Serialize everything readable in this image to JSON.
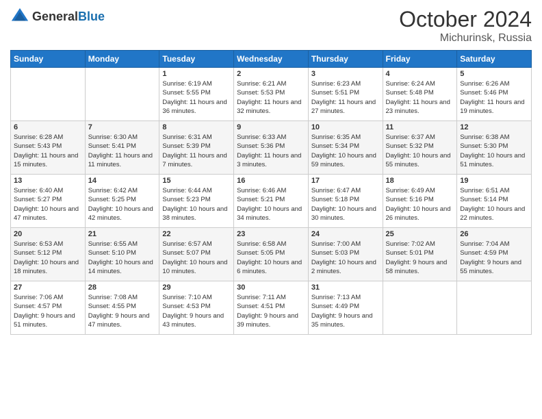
{
  "logo": {
    "general": "General",
    "blue": "Blue"
  },
  "header": {
    "month": "October 2024",
    "location": "Michurinsk, Russia"
  },
  "weekdays": [
    "Sunday",
    "Monday",
    "Tuesday",
    "Wednesday",
    "Thursday",
    "Friday",
    "Saturday"
  ],
  "weeks": [
    [
      {
        "day": "",
        "sunrise": "",
        "sunset": "",
        "daylight": ""
      },
      {
        "day": "",
        "sunrise": "",
        "sunset": "",
        "daylight": ""
      },
      {
        "day": "1",
        "sunrise": "Sunrise: 6:19 AM",
        "sunset": "Sunset: 5:55 PM",
        "daylight": "Daylight: 11 hours and 36 minutes."
      },
      {
        "day": "2",
        "sunrise": "Sunrise: 6:21 AM",
        "sunset": "Sunset: 5:53 PM",
        "daylight": "Daylight: 11 hours and 32 minutes."
      },
      {
        "day": "3",
        "sunrise": "Sunrise: 6:23 AM",
        "sunset": "Sunset: 5:51 PM",
        "daylight": "Daylight: 11 hours and 27 minutes."
      },
      {
        "day": "4",
        "sunrise": "Sunrise: 6:24 AM",
        "sunset": "Sunset: 5:48 PM",
        "daylight": "Daylight: 11 hours and 23 minutes."
      },
      {
        "day": "5",
        "sunrise": "Sunrise: 6:26 AM",
        "sunset": "Sunset: 5:46 PM",
        "daylight": "Daylight: 11 hours and 19 minutes."
      }
    ],
    [
      {
        "day": "6",
        "sunrise": "Sunrise: 6:28 AM",
        "sunset": "Sunset: 5:43 PM",
        "daylight": "Daylight: 11 hours and 15 minutes."
      },
      {
        "day": "7",
        "sunrise": "Sunrise: 6:30 AM",
        "sunset": "Sunset: 5:41 PM",
        "daylight": "Daylight: 11 hours and 11 minutes."
      },
      {
        "day": "8",
        "sunrise": "Sunrise: 6:31 AM",
        "sunset": "Sunset: 5:39 PM",
        "daylight": "Daylight: 11 hours and 7 minutes."
      },
      {
        "day": "9",
        "sunrise": "Sunrise: 6:33 AM",
        "sunset": "Sunset: 5:36 PM",
        "daylight": "Daylight: 11 hours and 3 minutes."
      },
      {
        "day": "10",
        "sunrise": "Sunrise: 6:35 AM",
        "sunset": "Sunset: 5:34 PM",
        "daylight": "Daylight: 10 hours and 59 minutes."
      },
      {
        "day": "11",
        "sunrise": "Sunrise: 6:37 AM",
        "sunset": "Sunset: 5:32 PM",
        "daylight": "Daylight: 10 hours and 55 minutes."
      },
      {
        "day": "12",
        "sunrise": "Sunrise: 6:38 AM",
        "sunset": "Sunset: 5:30 PM",
        "daylight": "Daylight: 10 hours and 51 minutes."
      }
    ],
    [
      {
        "day": "13",
        "sunrise": "Sunrise: 6:40 AM",
        "sunset": "Sunset: 5:27 PM",
        "daylight": "Daylight: 10 hours and 47 minutes."
      },
      {
        "day": "14",
        "sunrise": "Sunrise: 6:42 AM",
        "sunset": "Sunset: 5:25 PM",
        "daylight": "Daylight: 10 hours and 42 minutes."
      },
      {
        "day": "15",
        "sunrise": "Sunrise: 6:44 AM",
        "sunset": "Sunset: 5:23 PM",
        "daylight": "Daylight: 10 hours and 38 minutes."
      },
      {
        "day": "16",
        "sunrise": "Sunrise: 6:46 AM",
        "sunset": "Sunset: 5:21 PM",
        "daylight": "Daylight: 10 hours and 34 minutes."
      },
      {
        "day": "17",
        "sunrise": "Sunrise: 6:47 AM",
        "sunset": "Sunset: 5:18 PM",
        "daylight": "Daylight: 10 hours and 30 minutes."
      },
      {
        "day": "18",
        "sunrise": "Sunrise: 6:49 AM",
        "sunset": "Sunset: 5:16 PM",
        "daylight": "Daylight: 10 hours and 26 minutes."
      },
      {
        "day": "19",
        "sunrise": "Sunrise: 6:51 AM",
        "sunset": "Sunset: 5:14 PM",
        "daylight": "Daylight: 10 hours and 22 minutes."
      }
    ],
    [
      {
        "day": "20",
        "sunrise": "Sunrise: 6:53 AM",
        "sunset": "Sunset: 5:12 PM",
        "daylight": "Daylight: 10 hours and 18 minutes."
      },
      {
        "day": "21",
        "sunrise": "Sunrise: 6:55 AM",
        "sunset": "Sunset: 5:10 PM",
        "daylight": "Daylight: 10 hours and 14 minutes."
      },
      {
        "day": "22",
        "sunrise": "Sunrise: 6:57 AM",
        "sunset": "Sunset: 5:07 PM",
        "daylight": "Daylight: 10 hours and 10 minutes."
      },
      {
        "day": "23",
        "sunrise": "Sunrise: 6:58 AM",
        "sunset": "Sunset: 5:05 PM",
        "daylight": "Daylight: 10 hours and 6 minutes."
      },
      {
        "day": "24",
        "sunrise": "Sunrise: 7:00 AM",
        "sunset": "Sunset: 5:03 PM",
        "daylight": "Daylight: 10 hours and 2 minutes."
      },
      {
        "day": "25",
        "sunrise": "Sunrise: 7:02 AM",
        "sunset": "Sunset: 5:01 PM",
        "daylight": "Daylight: 9 hours and 58 minutes."
      },
      {
        "day": "26",
        "sunrise": "Sunrise: 7:04 AM",
        "sunset": "Sunset: 4:59 PM",
        "daylight": "Daylight: 9 hours and 55 minutes."
      }
    ],
    [
      {
        "day": "27",
        "sunrise": "Sunrise: 7:06 AM",
        "sunset": "Sunset: 4:57 PM",
        "daylight": "Daylight: 9 hours and 51 minutes."
      },
      {
        "day": "28",
        "sunrise": "Sunrise: 7:08 AM",
        "sunset": "Sunset: 4:55 PM",
        "daylight": "Daylight: 9 hours and 47 minutes."
      },
      {
        "day": "29",
        "sunrise": "Sunrise: 7:10 AM",
        "sunset": "Sunset: 4:53 PM",
        "daylight": "Daylight: 9 hours and 43 minutes."
      },
      {
        "day": "30",
        "sunrise": "Sunrise: 7:11 AM",
        "sunset": "Sunset: 4:51 PM",
        "daylight": "Daylight: 9 hours and 39 minutes."
      },
      {
        "day": "31",
        "sunrise": "Sunrise: 7:13 AM",
        "sunset": "Sunset: 4:49 PM",
        "daylight": "Daylight: 9 hours and 35 minutes."
      },
      {
        "day": "",
        "sunrise": "",
        "sunset": "",
        "daylight": ""
      },
      {
        "day": "",
        "sunrise": "",
        "sunset": "",
        "daylight": ""
      }
    ]
  ]
}
